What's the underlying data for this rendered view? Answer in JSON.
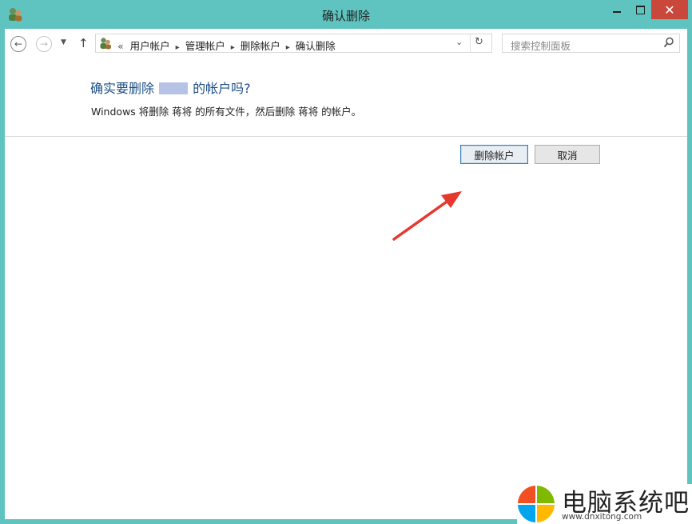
{
  "window": {
    "title": "确认删除",
    "min_label": "",
    "max_label": "",
    "close_label": "✕"
  },
  "nav": {
    "back": "←",
    "forward": "→",
    "recent": "▼",
    "up": "↑"
  },
  "address": {
    "lead": "«",
    "crumbs": [
      "用户帐户",
      "管理帐户",
      "删除帐户",
      "确认删除"
    ],
    "separator": "▸",
    "dropdown": "⌄",
    "refresh": "↻"
  },
  "search": {
    "placeholder": "搜索控制面板"
  },
  "dialog": {
    "heading_before": "确实要删除 ",
    "heading_after": " 的帐户吗?",
    "description": "Windows 将删除 蒋将 的所有文件，然后删除 蒋将 的帐户。"
  },
  "buttons": {
    "delete": "删除帐户",
    "cancel": "取消"
  },
  "annotation": {
    "arrow_color": "#e5392f"
  },
  "watermark": {
    "text": "电脑系统吧",
    "url": "www.dnxitong.com",
    "colors": [
      "#f25022",
      "#7fba00",
      "#00a4ef",
      "#ffb900"
    ]
  }
}
